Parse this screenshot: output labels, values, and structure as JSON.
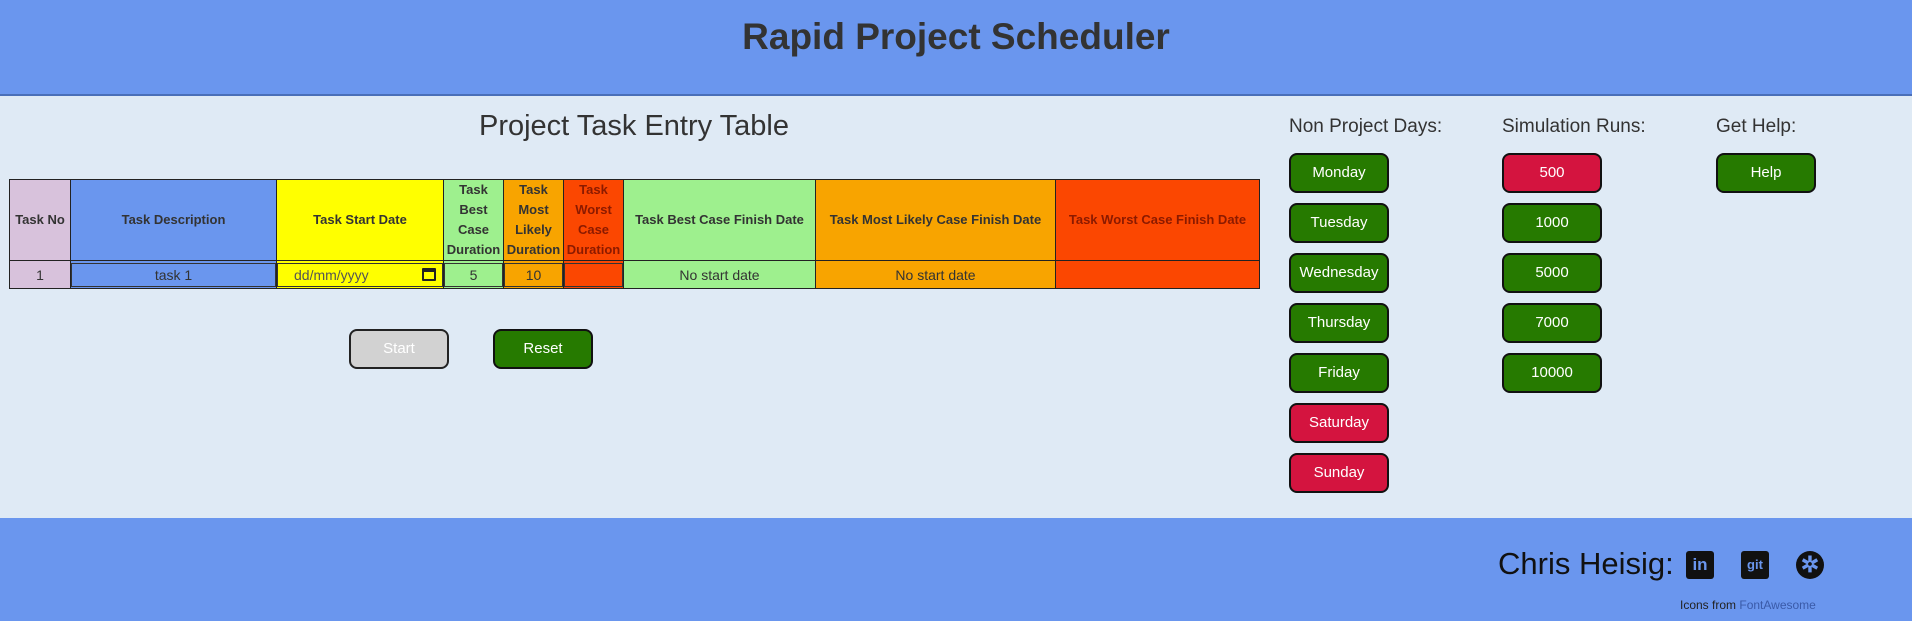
{
  "header": {
    "title": "Rapid Project Scheduler"
  },
  "table": {
    "title": "Project Task Entry Table",
    "headers": {
      "task_no": "Task No",
      "description": "Task Description",
      "start_date": "Task Start Date",
      "best_duration": "Task Best Case Duration",
      "likely_duration": "Task Most Likely Duration",
      "worst_duration": "Task Worst Case Duration",
      "best_finish": "Task Best Case Finish Date",
      "likely_finish": "Task Most Likely Case Finish Date",
      "worst_finish": "Task Worst Case Finish Date"
    },
    "rows": [
      {
        "task_no": "1",
        "description": "task 1",
        "start_date_placeholder": "dd/mm/yyyy",
        "best_duration": "5",
        "likely_duration": "10",
        "worst_duration": "",
        "best_finish": "No start date",
        "likely_finish": "No start date",
        "worst_finish": ""
      }
    ]
  },
  "actions": {
    "start_label": "Start",
    "reset_label": "Reset"
  },
  "non_project_days": {
    "title": "Non Project Days:",
    "days": [
      {
        "label": "Monday",
        "state": "green"
      },
      {
        "label": "Tuesday",
        "state": "green"
      },
      {
        "label": "Wednesday",
        "state": "green"
      },
      {
        "label": "Thursday",
        "state": "green"
      },
      {
        "label": "Friday",
        "state": "green"
      },
      {
        "label": "Saturday",
        "state": "red"
      },
      {
        "label": "Sunday",
        "state": "red"
      }
    ]
  },
  "simulation_runs": {
    "title": "Simulation Runs:",
    "options": [
      {
        "label": "500",
        "state": "red"
      },
      {
        "label": "1000",
        "state": "green"
      },
      {
        "label": "5000",
        "state": "green"
      },
      {
        "label": "7000",
        "state": "green"
      },
      {
        "label": "10000",
        "state": "green"
      }
    ]
  },
  "help": {
    "title": "Get Help:",
    "button_label": "Help"
  },
  "footer": {
    "author": "Chris Heisig:",
    "icons": [
      "linkedin-icon",
      "git-icon",
      "react-icon"
    ],
    "icon_glyphs": {
      "linkedin": "in",
      "git": "git",
      "react": "✲"
    },
    "credits_prefix": "Icons from ",
    "credits_link": "FontAwesome"
  },
  "colors": {
    "header_bg": "#6a96ee",
    "main_bg": "#dfeaf5",
    "active_green": "#267a00",
    "active_red": "#d4143f",
    "task_no": "#d8c2dc",
    "description": "#6a96ee",
    "start_date": "#ffff00",
    "best": "#9ef08e",
    "likely": "#f8a400",
    "worst": "#fb4701"
  }
}
